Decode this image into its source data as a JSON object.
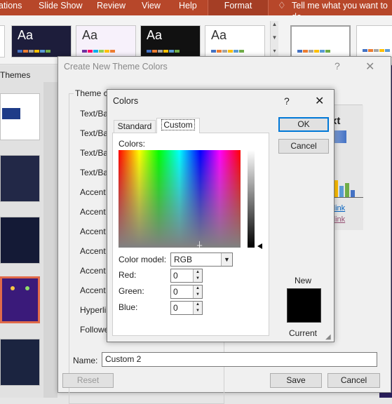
{
  "ribbon": {
    "tabs": [
      "ations",
      "Slide Show",
      "Review",
      "View",
      "Help",
      "Format"
    ],
    "tell_me": "Tell me what you want to do",
    "theme_thumb_label": "Aa"
  },
  "left_panel": {
    "themes_label": "Themes"
  },
  "theme_dialog": {
    "title": "Create New Theme Colors",
    "help": "?",
    "close": "✕",
    "group_label": "Theme co",
    "rows": [
      "Text/Bac",
      "Text/Bac",
      "Text/Bac",
      "Text/Bac",
      "Accent 1",
      "Accent 2",
      "Accent 3",
      "Accent 4",
      "Accent 5",
      "Accent 6",
      "Hyperlin",
      "Followe"
    ],
    "sample_text": "xt",
    "sample_link1": "rlink",
    "sample_link2": "rlink",
    "name_label": "Name:",
    "name_value": "Custom 2",
    "reset_label": "Reset",
    "save_label": "Save",
    "cancel_label": "Cancel"
  },
  "colors_dialog": {
    "title": "Colors",
    "help": "?",
    "close": "✕",
    "tab_standard": "Standard",
    "tab_custom": "Custom",
    "colors_label": "Colors:",
    "color_model_label": "Color model:",
    "color_model_value": "RGB",
    "red_label": "Red:",
    "red_value": "0",
    "green_label": "Green:",
    "green_value": "0",
    "blue_label": "Blue:",
    "blue_value": "0",
    "ok_label": "OK",
    "cancel_label": "Cancel",
    "new_label": "New",
    "current_label": "Current",
    "new_color": "#000000"
  }
}
